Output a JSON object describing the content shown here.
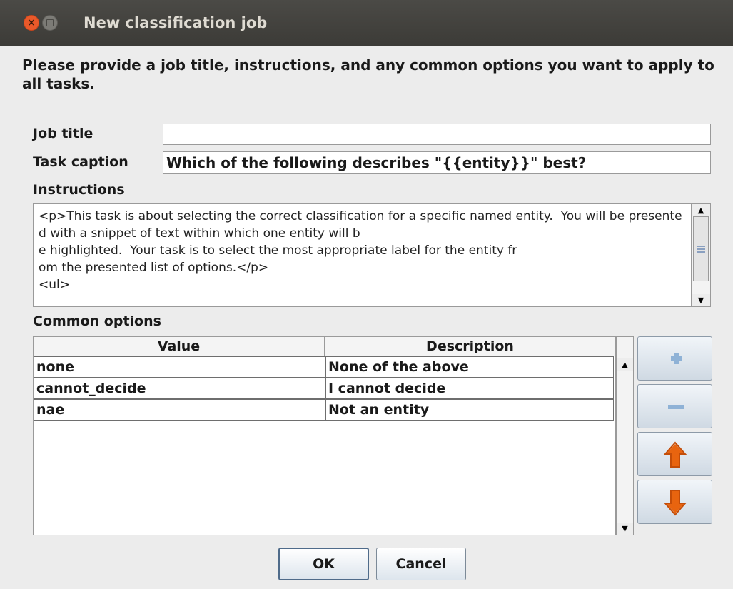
{
  "window": {
    "title": "New classification job"
  },
  "intro_text": "Please provide a job title, instructions, and any common options you want to apply to all tasks.",
  "fields": {
    "job_title": {
      "label": "Job title",
      "value": ""
    },
    "task_caption": {
      "label": "Task caption",
      "value": "Which of the following describes \"{{entity}}\" best?"
    },
    "instructions": {
      "label": "Instructions",
      "value": "<p>This task is about selecting the correct classification for a specific named entity.  You will be presented with a snippet of text within which one entity will b\ne highlighted.  Your task is to select the most appropriate label for the entity fr\nom the presented list of options.</p>\n<ul>"
    }
  },
  "common_options": {
    "label": "Common options",
    "columns": [
      "Value",
      "Description"
    ],
    "rows": [
      {
        "value": "none",
        "description": "None of the above"
      },
      {
        "value": "cannot_decide",
        "description": "I cannot decide"
      },
      {
        "value": "nae",
        "description": "Not an entity"
      }
    ]
  },
  "side_buttons": [
    "plus-icon",
    "minus-icon",
    "arrow-up-icon",
    "arrow-down-icon"
  ],
  "buttons": {
    "ok": "OK",
    "cancel": "Cancel"
  },
  "colors": {
    "titlebar": "#3c3b37",
    "close_button": "#e9592a",
    "arrow_orange": "#e8640f",
    "plus_minus_blue": "#8fb2d6"
  }
}
